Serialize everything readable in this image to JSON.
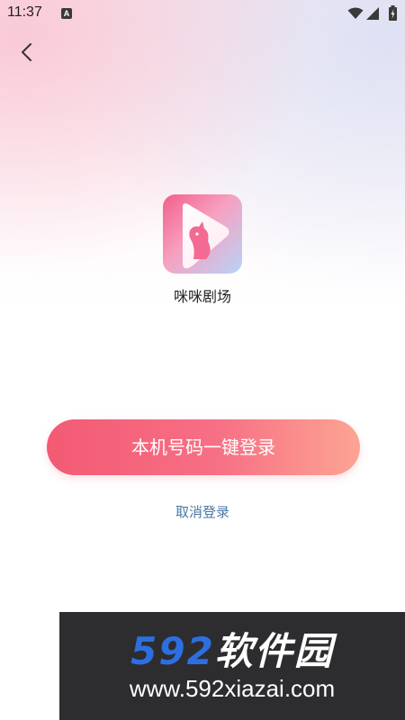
{
  "status_bar": {
    "time": "11:37",
    "notification_icon": "a-icon",
    "wifi_icon": "wifi-icon",
    "signal_icon": "signal-icon",
    "battery_icon": "battery-icon"
  },
  "nav": {
    "back_icon": "chevron-left-icon"
  },
  "app": {
    "logo_icon": "cat-play-logo",
    "name": "咪咪剧场"
  },
  "login": {
    "one_click_label": "本机号码一键登录",
    "cancel_label": "取消登录"
  },
  "watermark": {
    "brand_number": "592",
    "brand_text": "软件园",
    "url": "www.592xiazai.com"
  },
  "colors": {
    "login_gradient_start": "#f35a74",
    "login_gradient_end": "#fca592",
    "cancel_link": "#4a77a8",
    "watermark_bg": "#2d2d30",
    "watermark_number": "#2d6fe0"
  }
}
